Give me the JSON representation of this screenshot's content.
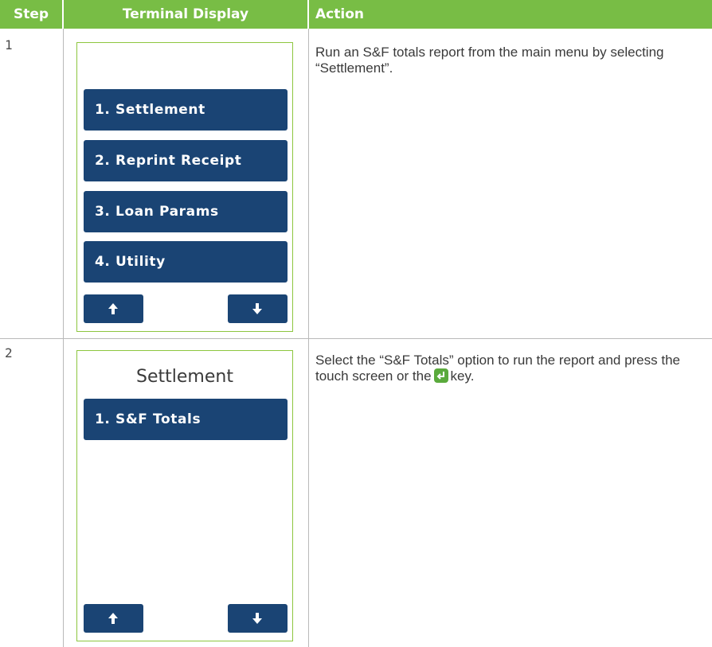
{
  "header": {
    "step": "Step",
    "terminal_display": "Terminal Display",
    "action": "Action"
  },
  "rows": [
    {
      "step": "1",
      "screen": {
        "title": "",
        "menu_items": [
          "1. Settlement",
          "2. Reprint Receipt",
          "3. Loan Params",
          "4. Utility"
        ],
        "nav": {
          "up_icon": "arrow-up-icon",
          "down_icon": "arrow-down-icon"
        }
      },
      "action": "Run an S&F totals report from the main menu by selecting “Settlement”."
    },
    {
      "step": "2",
      "screen": {
        "title": "Settlement",
        "menu_items": [
          "1. S&F Totals"
        ],
        "nav": {
          "up_icon": "arrow-up-icon",
          "down_icon": "arrow-down-icon"
        }
      },
      "action_before_key": "Select the “S&F Totals” option to run the report and press the touch screen or the",
      "action_key_icon": "enter-key-icon",
      "action_after_key": "key."
    }
  ],
  "colors": {
    "header_bg": "#78bd45",
    "button_bg": "#1a4474",
    "screen_border": "#8dc63f",
    "enter_key": "#5aaa3c"
  }
}
